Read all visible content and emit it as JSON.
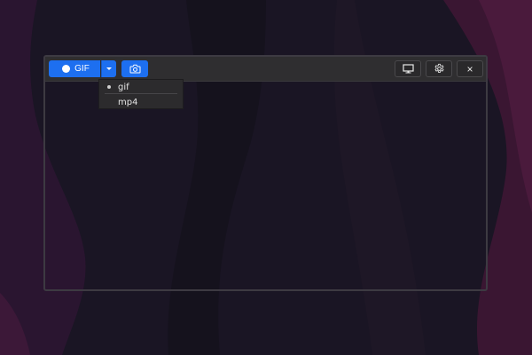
{
  "toolbar": {
    "record_label": "GIF",
    "icons": {
      "record": "record-dot-icon",
      "dropdown": "chevron-down-icon",
      "screenshot": "camera-icon",
      "monitor": "monitor-icon",
      "settings": "gear-icon",
      "close": "close-icon"
    },
    "close_glyph": "×"
  },
  "format_menu": {
    "items": [
      {
        "label": "gif",
        "selected": true
      },
      {
        "label": "mp4",
        "selected": false
      }
    ]
  },
  "colors": {
    "accent": "#1d6ff0",
    "toolbar_bg": "#2f2e30",
    "menu_bg": "#2c2b2d",
    "wallpaper_base": "#1a1424",
    "wallpaper_accent": "#4a1a3c"
  }
}
